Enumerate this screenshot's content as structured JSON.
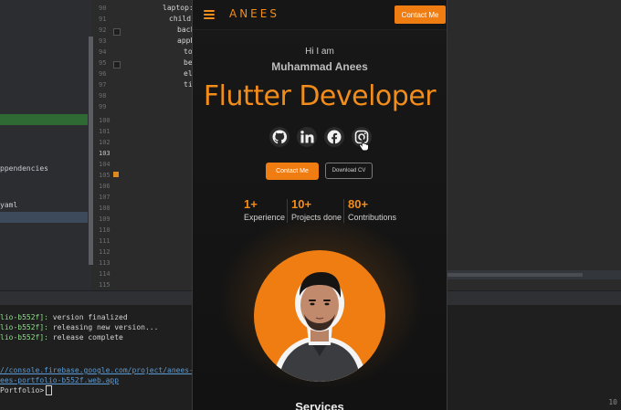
{
  "ide": {
    "sidebar": [
      {
        "text": "ppendencies"
      },
      {
        "text": "yaml"
      }
    ],
    "line_numbers": [
      "90",
      "91",
      "92",
      "93",
      "94",
      "95",
      "96",
      "97",
      "98",
      "99",
      "100",
      "101",
      "102",
      "103",
      "104",
      "105",
      "106",
      "107",
      "108",
      "109",
      "110",
      "111",
      "112",
      "113",
      "114",
      "115"
    ],
    "current_line": "103",
    "code_lines": [
      "laptop:",
      "child:",
      "back",
      "appB",
      "to",
      "be",
      "el",
      "ti"
    ],
    "terminal": {
      "lines": [
        {
          "prefix": "lio-b552f]:",
          "text": " version finalized"
        },
        {
          "prefix": "lio-b552f]:",
          "text": " releasing new version..."
        },
        {
          "prefix": "lio-b552f]:",
          "text": " release complete"
        }
      ],
      "console_link": "//console.firebase.google.com/project/anees-portfolio-",
      "hosting_link": "ees-portfolio-b552f.web.app",
      "prompt": "Portfolio>",
      "corner_number": "10"
    }
  },
  "app": {
    "brand": "ANEES",
    "contact_top": "Contact Me",
    "greeting": "Hi I am",
    "name": "Muhammad Anees",
    "role": "Flutter Developer",
    "social_icons": [
      "github-icon",
      "linkedin-icon",
      "facebook-icon",
      "instagram-icon"
    ],
    "contact_button": "Contact Me",
    "cv_button": "Download CV",
    "stats": [
      {
        "value": "1+",
        "label": "Experience"
      },
      {
        "value": "10+",
        "label": "Projects done"
      },
      {
        "value": "80+",
        "label": "Contributions"
      }
    ],
    "section_title": "Services"
  },
  "colors": {
    "accent": "#f07d12",
    "background": "#121212",
    "ide_background": "#2b2b2b",
    "terminal_background": "#1f1f1f"
  }
}
